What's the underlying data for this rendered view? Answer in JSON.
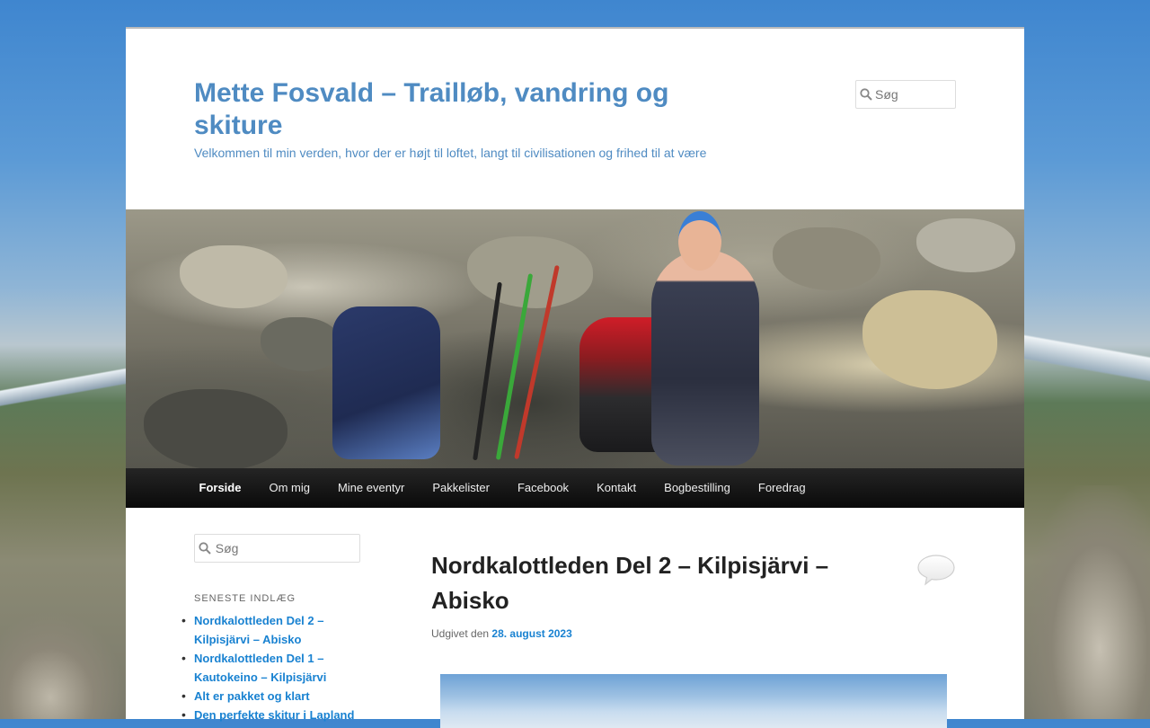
{
  "site": {
    "title": "Mette Fosvald – Trailløb, vandring og skiture",
    "description": "Velkommen til min verden, hvor der er højt til loftet, langt til civilisationen og frihed til at være"
  },
  "header_search": {
    "placeholder": "Søg"
  },
  "nav": {
    "items": [
      {
        "label": "Forside"
      },
      {
        "label": "Om mig"
      },
      {
        "label": "Mine eventyr"
      },
      {
        "label": "Pakkelister"
      },
      {
        "label": "Facebook"
      },
      {
        "label": "Kontakt"
      },
      {
        "label": "Bogbestilling"
      },
      {
        "label": "Foredrag"
      }
    ],
    "current": "Forside"
  },
  "sidebar": {
    "search_placeholder": "Søg",
    "recent_title": "SENESTE INDLÆG",
    "recent_posts": [
      {
        "label": "Nordkalottleden Del 2 – Kilpisjärvi – Abisko"
      },
      {
        "label": "Nordkalottleden Del 1 – Kautokeino – Kilpisjärvi"
      },
      {
        "label": "Alt er pakket og klart"
      },
      {
        "label": "Den perfekte skitur i Lapland"
      }
    ]
  },
  "post": {
    "title": "Nordkalottleden Del 2 – Kilpisjärvi – Abisko",
    "meta_prefix": "Udgivet den",
    "date": "28. august 2023"
  },
  "colors": {
    "link": "#1982d1",
    "site_title": "#4f8bc2",
    "nav_bg": "#111111"
  },
  "icons": {
    "search": "search-icon",
    "comment": "comment-bubble-icon"
  }
}
